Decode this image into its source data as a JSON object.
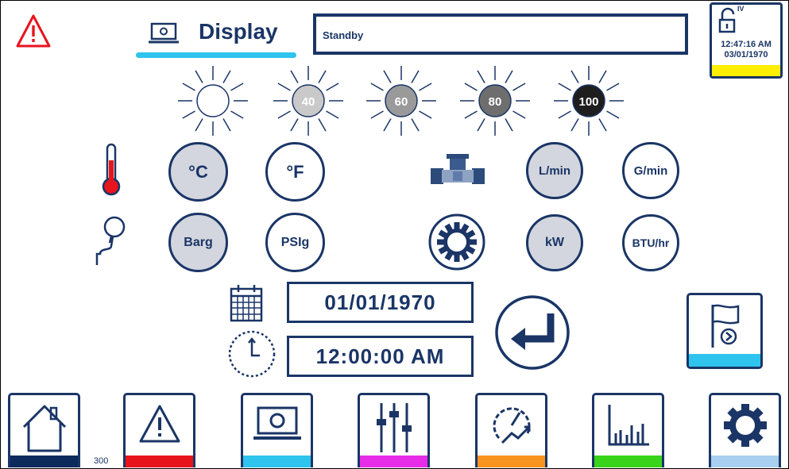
{
  "header": {
    "title": "Display",
    "status_text": "Standby",
    "access_level": "IV",
    "clock_time": "12:47:16 AM",
    "clock_date": "03/01/1970"
  },
  "brightness": {
    "levels": [
      "",
      "40",
      "60",
      "80",
      "100"
    ]
  },
  "units": {
    "temperature": [
      "°C",
      "°F"
    ],
    "flow": [
      "L/min",
      "G/min"
    ],
    "pressure": [
      "Barg",
      "PSIg"
    ],
    "power": [
      "kW",
      "BTU/hr"
    ]
  },
  "datetime": {
    "date": "01/01/1970",
    "time": "12:00:00 AM"
  },
  "footer": {
    "counter": "300",
    "nav_colors": [
      "#0d2a5c",
      "#e8141c",
      "#2ec4ee",
      "#e62ce6",
      "#f7931e",
      "#39d31a",
      "#a9cff0"
    ]
  }
}
